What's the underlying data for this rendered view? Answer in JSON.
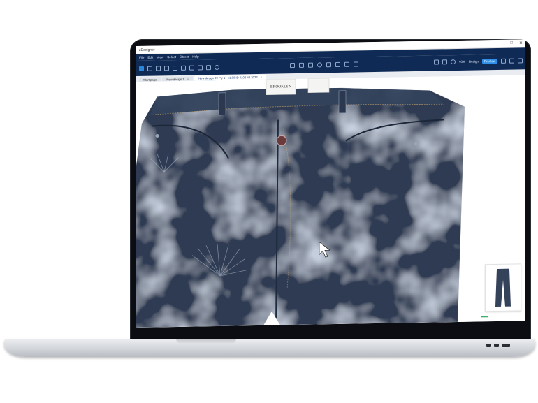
{
  "window": {
    "title": "zDesigner",
    "controls": [
      "–",
      "□",
      "✕"
    ]
  },
  "menu": [
    "File",
    "Edit",
    "View",
    "Select",
    "Object",
    "Help"
  ],
  "toolbar": {
    "zoom": "40%",
    "mode_label": "Design",
    "mode_button": "Preview"
  },
  "tabs": [
    {
      "label": "Start page",
      "active": false
    },
    {
      "label": "New design 1",
      "active": false
    },
    {
      "label": "New design 2 / Ply 1 - v1.00 ID 0102-43 2022",
      "active": true
    }
  ],
  "garment": {
    "label_brand": "BROOKLYN",
    "colors": {
      "denim": "#2e3b52",
      "denim_light": "#8f9fb7",
      "label": "#f4f4f2",
      "button": "#6b3a3a"
    }
  },
  "accent": "#2f8fe8",
  "header_bg": "#0f2a55"
}
